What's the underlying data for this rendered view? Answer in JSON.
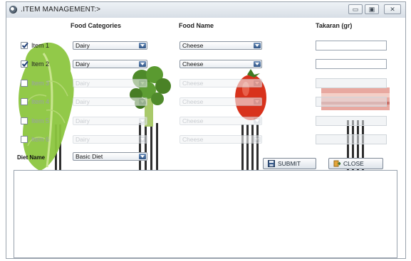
{
  "window": {
    "title": ".ITEM MANAGEMENT:>",
    "controls": {
      "minimize": "▭",
      "maximize": "▣",
      "close": "✕"
    }
  },
  "headers": {
    "food_categories": "Food Categories",
    "food_name": "Food Name",
    "takaran": "Takaran (gr)"
  },
  "items": [
    {
      "label": "Item 1",
      "checked": true,
      "category": "Dairy",
      "food": "Cheese",
      "takaran": "",
      "enabled": true
    },
    {
      "label": "Item 2",
      "checked": true,
      "category": "Dairy",
      "food": "Cheese",
      "takaran": "",
      "enabled": true
    },
    {
      "label": "Item 3",
      "checked": false,
      "category": "Dairy",
      "food": "Cheese",
      "takaran": "",
      "enabled": false
    },
    {
      "label": "Item 4",
      "checked": false,
      "category": "Dairy",
      "food": "Cheese",
      "takaran": "",
      "enabled": false
    },
    {
      "label": "Item 5",
      "checked": false,
      "category": "Dairy",
      "food": "Cheese",
      "takaran": "",
      "enabled": false
    },
    {
      "label": "Item 6",
      "checked": false,
      "category": "Dairy",
      "food": "Cheese",
      "takaran": "",
      "enabled": false
    }
  ],
  "diet": {
    "label": "Diet Name",
    "value": "Basic Diet"
  },
  "buttons": {
    "submit": "SUBMIT",
    "close": "CLOSE"
  },
  "icons": {
    "submit": "floppy-disk-icon",
    "close": "door-exit-icon"
  },
  "colors": {
    "combo_arrow": "#2f5587",
    "titlebar": "#d7dee6",
    "lettuce": "#7dbb3a",
    "broccoli": "#4e8a2a",
    "tomato": "#d8321c"
  }
}
